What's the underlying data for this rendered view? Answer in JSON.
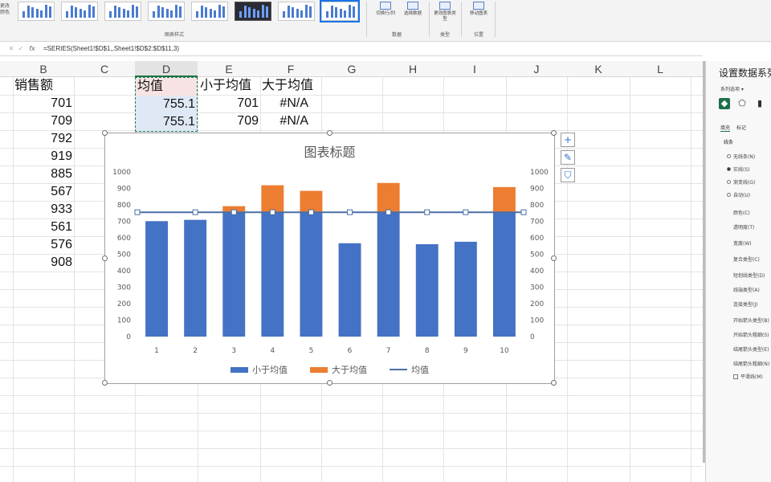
{
  "ribbon": {
    "chart_styles_label": "图表样式",
    "data_group_label": "数据",
    "type_group_label": "类型",
    "location_group_label": "位置",
    "left_cut_label": "更改颜色",
    "buttons": {
      "switch_row_col": "切换行/列",
      "select_data": "选择数据",
      "change_chart_type": "更改图表类型",
      "move_chart": "移动图表"
    }
  },
  "formula_bar": {
    "formula": "=SERIES(Sheet1!$D$1,,Sheet1!$D$2:$D$11,3)"
  },
  "columns": [
    "B",
    "C",
    "D",
    "E",
    "F",
    "G",
    "H",
    "I",
    "J",
    "K",
    "L"
  ],
  "sheet": {
    "b_header": "销售额",
    "b_values": [
      "701",
      "709",
      "792",
      "919",
      "885",
      "567",
      "933",
      "561",
      "576",
      "908"
    ],
    "d_header": "均值",
    "d_values": [
      "755.1",
      "755.1"
    ],
    "e_header": "小于均值",
    "e_values": [
      "701",
      "709"
    ],
    "f_header": "大于均值",
    "f_values": [
      "#N/A",
      "#N/A"
    ]
  },
  "chart_data": {
    "type": "bar",
    "title": "图表标题",
    "categories": [
      "1",
      "2",
      "3",
      "4",
      "5",
      "6",
      "7",
      "8",
      "9",
      "10"
    ],
    "series": [
      {
        "name": "小于均值",
        "type": "stacked-bar",
        "values": [
          701,
          709,
          755.1,
          755.1,
          755.1,
          567,
          755.1,
          561,
          576,
          755.1
        ]
      },
      {
        "name": "大于均值",
        "type": "stacked-bar",
        "values": [
          0,
          0,
          36.9,
          163.9,
          129.9,
          0,
          177.9,
          0,
          0,
          152.9
        ]
      },
      {
        "name": "均值",
        "type": "line",
        "values": [
          755.1,
          755.1,
          755.1,
          755.1,
          755.1,
          755.1,
          755.1,
          755.1,
          755.1,
          755.1
        ]
      }
    ],
    "y_ticks": [
      "0",
      "100",
      "200",
      "300",
      "400",
      "500",
      "600",
      "700",
      "800",
      "900",
      "1000"
    ],
    "ylim": [
      0,
      1000
    ],
    "secondary_y_ticks": [
      "0",
      "100",
      "200",
      "300",
      "400",
      "500",
      "600",
      "700",
      "800",
      "900",
      "1000"
    ],
    "legend_position": "bottom",
    "grid": false,
    "colors": {
      "below": "#4472c4",
      "above": "#ed7d31",
      "mean": "#4a6fa5"
    }
  },
  "chart_tools": {
    "elements_icon": "plus-icon",
    "styles_icon": "brush-icon",
    "filters_icon": "filter-icon"
  },
  "pane": {
    "title": "设置数据系列格式",
    "subtitle": "系列选项 ▾",
    "tabs": [
      "填充",
      "标记"
    ],
    "section": "线条",
    "radios": [
      {
        "label": "无线条(N)",
        "checked": false
      },
      {
        "label": "实线(S)",
        "checked": true
      },
      {
        "label": "渐变线(G)",
        "checked": false
      },
      {
        "label": "自动(U)",
        "checked": false
      }
    ],
    "rows": [
      "颜色(C)",
      "透明度(T)",
      "宽度(W)",
      "复合类型(C)",
      "短划线类型(D)",
      "线端类型(A)",
      "连接类型(J)",
      "开始箭头类型(B)",
      "开始箭头粗细(S)",
      "结尾箭头类型(E)",
      "结尾箭头粗细(N)"
    ],
    "smooth_label": "平滑线(M)"
  }
}
